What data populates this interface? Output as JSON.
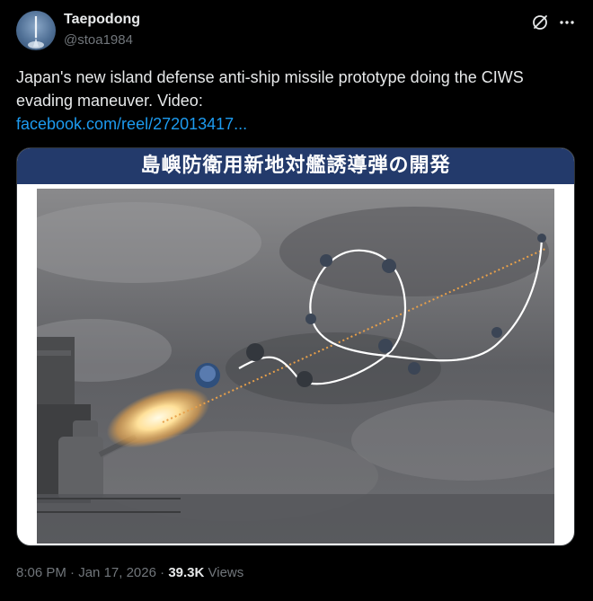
{
  "author": {
    "name": "Taepodong",
    "handle": "@stoa1984"
  },
  "tweet": {
    "text": "Japan's new island defense anti-ship missile prototype doing the CIWS evading maneuver. Video:",
    "link": "facebook.com/reel/272013417..."
  },
  "media": {
    "banner_text": "島嶼防衛用新地対艦誘導弾の開発"
  },
  "meta": {
    "time": "8:06 PM",
    "separator": " · ",
    "date": "Jan 17, 2026",
    "views_count": "39.3K",
    "views_label": " Views"
  },
  "icons": {
    "grok": "grok-icon",
    "more": "more-icon"
  },
  "colors": {
    "background": "#000000",
    "text": "#e7e9ea",
    "muted": "#71767b",
    "link": "#1d9bf0",
    "banner": "#233a6b"
  }
}
